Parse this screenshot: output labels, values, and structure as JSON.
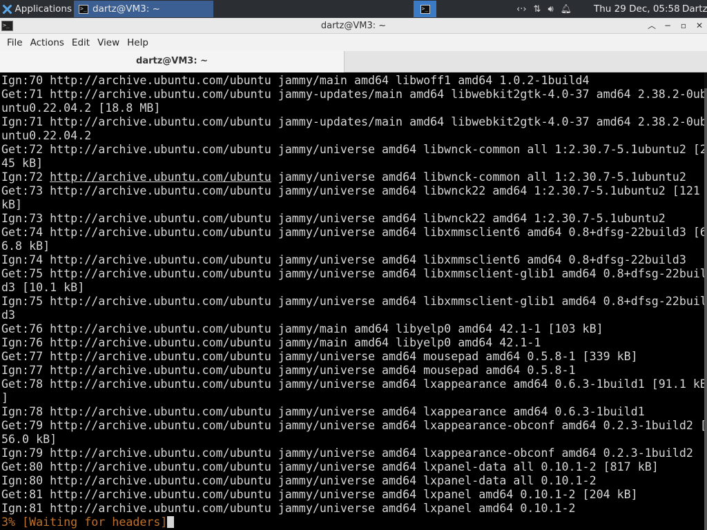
{
  "panel": {
    "applications_label": "Applications",
    "task_title": "dartz@VM3: ~",
    "clock": "Thu 29 Dec, 05:58",
    "user": "Dartz"
  },
  "window": {
    "title": "dartz@VM3: ~",
    "menu": [
      "File",
      "Actions",
      "Edit",
      "View",
      "Help"
    ],
    "tab_label": "dartz@VM3: ~"
  },
  "terminal": {
    "lines": [
      "Ign:70 http://archive.ubuntu.com/ubuntu jammy/main amd64 libwoff1 amd64 1.0.2-1build4",
      "Get:71 http://archive.ubuntu.com/ubuntu jammy-updates/main amd64 libwebkit2gtk-4.0-37 amd64 2.38.2-0ub",
      "untu0.22.04.2 [18.8 MB]",
      "Ign:71 http://archive.ubuntu.com/ubuntu jammy-updates/main amd64 libwebkit2gtk-4.0-37 amd64 2.38.2-0ub",
      "untu0.22.04.2",
      "Get:72 http://archive.ubuntu.com/ubuntu jammy/universe amd64 libwnck-common all 1:2.30.7-5.1ubuntu2 [2",
      "45 kB]",
      "Ign:72 http://archive.ubuntu.com/ubuntu jammy/universe amd64 libwnck-common all 1:2.30.7-5.1ubuntu2",
      "Get:73 http://archive.ubuntu.com/ubuntu jammy/universe amd64 libwnck22 amd64 1:2.30.7-5.1ubuntu2 [121",
      "kB]",
      "Ign:73 http://archive.ubuntu.com/ubuntu jammy/universe amd64 libwnck22 amd64 1:2.30.7-5.1ubuntu2",
      "Get:74 http://archive.ubuntu.com/ubuntu jammy/universe amd64 libxmmsclient6 amd64 0.8+dfsg-22build3 [6",
      "6.8 kB]",
      "Ign:74 http://archive.ubuntu.com/ubuntu jammy/universe amd64 libxmmsclient6 amd64 0.8+dfsg-22build3",
      "Get:75 http://archive.ubuntu.com/ubuntu jammy/universe amd64 libxmmsclient-glib1 amd64 0.8+dfsg-22buil",
      "d3 [10.1 kB]",
      "Ign:75 http://archive.ubuntu.com/ubuntu jammy/universe amd64 libxmmsclient-glib1 amd64 0.8+dfsg-22buil",
      "d3",
      "Get:76 http://archive.ubuntu.com/ubuntu jammy/main amd64 libyelp0 amd64 42.1-1 [103 kB]",
      "Ign:76 http://archive.ubuntu.com/ubuntu jammy/main amd64 libyelp0 amd64 42.1-1",
      "Get:77 http://archive.ubuntu.com/ubuntu jammy/universe amd64 mousepad amd64 0.5.8-1 [339 kB]",
      "Ign:77 http://archive.ubuntu.com/ubuntu jammy/universe amd64 mousepad amd64 0.5.8-1",
      "Get:78 http://archive.ubuntu.com/ubuntu jammy/universe amd64 lxappearance amd64 0.6.3-1build1 [91.1 kB",
      "]",
      "Ign:78 http://archive.ubuntu.com/ubuntu jammy/universe amd64 lxappearance amd64 0.6.3-1build1",
      "Get:79 http://archive.ubuntu.com/ubuntu jammy/universe amd64 lxappearance-obconf amd64 0.2.3-1build2 [",
      "56.0 kB]",
      "Ign:79 http://archive.ubuntu.com/ubuntu jammy/universe amd64 lxappearance-obconf amd64 0.2.3-1build2",
      "Get:80 http://archive.ubuntu.com/ubuntu jammy/universe amd64 lxpanel-data all 0.10.1-2 [817 kB]",
      "Ign:80 http://archive.ubuntu.com/ubuntu jammy/universe amd64 lxpanel-data all 0.10.1-2",
      "Get:81 http://archive.ubuntu.com/ubuntu jammy/universe amd64 lxpanel amd64 0.10.1-2 [204 kB]",
      "Ign:81 http://archive.ubuntu.com/ubuntu jammy/universe amd64 lxpanel amd64 0.10.1-2"
    ],
    "underlined_line_index": 7,
    "underlined_url": "http://archive.ubuntu.com/ubuntu",
    "status_line": "3% [Waiting for headers]",
    "status_color": "#c0712a"
  }
}
